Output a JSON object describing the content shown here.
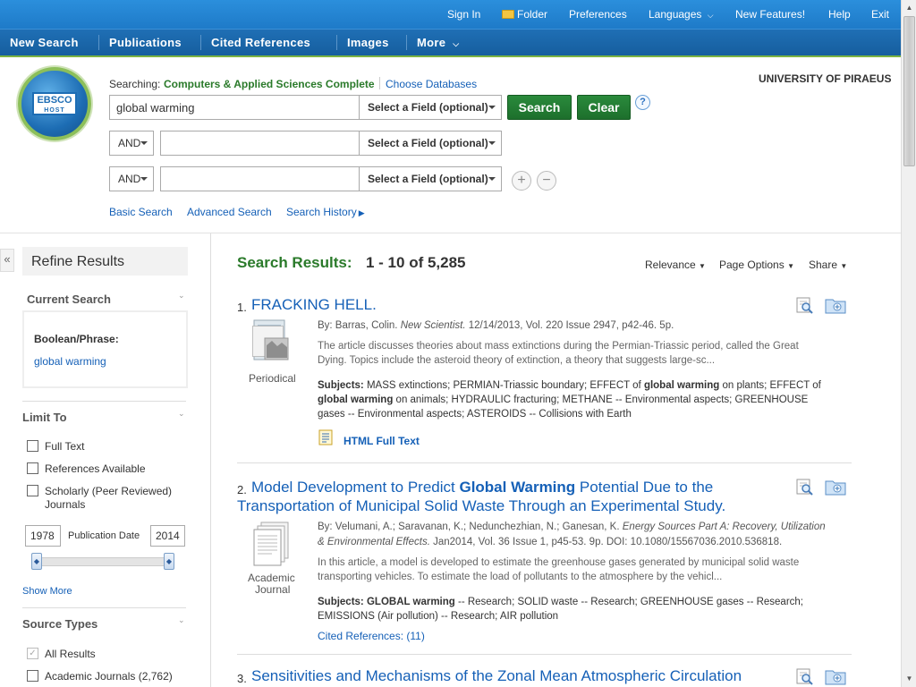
{
  "topbar": {
    "sign_in": "Sign In",
    "folder": "Folder",
    "preferences": "Preferences",
    "languages": "Languages",
    "new_features": "New Features!",
    "help": "Help",
    "exit": "Exit"
  },
  "nav": {
    "new_search": "New Search",
    "publications": "Publications",
    "cited_references": "Cited References",
    "images": "Images",
    "more": "More"
  },
  "logo": {
    "line1": "EBSCO",
    "line2": "HOST"
  },
  "search": {
    "searching_label": "Searching:",
    "database": "Computers & Applied Sciences Complete",
    "choose_databases": "Choose Databases",
    "query1": "global warming",
    "field_select": "Select a Field (optional)",
    "bool1": "AND",
    "bool2": "AND",
    "search_btn": "Search",
    "clear_btn": "Clear",
    "help": "?",
    "basic_search": "Basic Search",
    "advanced_search": "Advanced Search",
    "search_history": "Search History"
  },
  "institution": "UNIVERSITY OF PIRAEUS",
  "sidebar": {
    "collapse": "«",
    "refine_results": "Refine Results",
    "current_search": "Current Search",
    "boolean_phrase": "Boolean/Phrase:",
    "current_term": "global warming",
    "limit_to": "Limit To",
    "full_text": "Full Text",
    "references_available": "References Available",
    "scholarly_1": "Scholarly (Peer Reviewed)",
    "scholarly_2": "Journals",
    "date_from": "1978",
    "publication_date": "Publication Date",
    "date_to": "2014",
    "show_more": "Show More",
    "source_types": "Source Types",
    "all_results": "All Results",
    "academic_journals": "Academic Journals (2,762)"
  },
  "results": {
    "heading": "Search Results:",
    "range": "1 - 10 of 5,285",
    "relevance": "Relevance",
    "page_options": "Page Options",
    "share": "Share",
    "items": [
      {
        "num": "1.",
        "title": "FRACKING HELL.",
        "type": "Periodical",
        "meta_by": "By: Barras, Colin.",
        "meta_source": "New Scientist.",
        "meta_rest": "12/14/2013, Vol. 220 Issue 2947, p42-46. 5p.",
        "abs1": "The article discusses theories about mass extinctions during the Permian-Triassic period, called the Great",
        "abs2": "Dying. Topics include the asteroid theory of extinction, a theory that suggests large-sc...",
        "subj_label": "Subjects:",
        "subj1": "MASS extinctions; PERMIAN-Triassic boundary; EFFECT of",
        "subj1b": "global warming",
        "subj1c": "on plants; EFFECT of",
        "subj2a": "global warming",
        "subj2b": "on animals; HYDRAULIC fracturing; METHANE -- Environmental aspects; GREENHOUSE",
        "subj3": "gases -- Environmental aspects; ASTEROIDS -- Collisions with Earth",
        "fulltext": "HTML Full Text"
      },
      {
        "num": "2.",
        "title_a": "Model Development to Predict",
        "title_b": "Global Warming",
        "title_c": "Potential Due to the",
        "title_line2": "Transportation of Municipal Solid Waste Through an Experimental Study.",
        "type1": "Academic",
        "type2": "Journal",
        "meta1_by": "By: Velumani, A.; Saravanan, K.; Nedunchezhian, N.; Ganesan, K.",
        "meta1_source": "Energy Sources Part A: Recovery, Utilization",
        "meta2_source": "& Environmental Effects.",
        "meta2_rest": "Jan2014, Vol. 36 Issue 1, p45-53. 9p. DOI: 10.1080/15567036.2010.536818.",
        "abs1": "In this article, a model is developed to estimate the greenhouse gases generated by municipal solid waste",
        "abs2": "transporting vehicles. To estimate the load of pollutants to the atmosphere by the vehicl...",
        "subj_label": "Subjects:",
        "subj1b": "GLOBAL warming",
        "subj1c": "-- Research; SOLID waste -- Research; GREENHOUSE gases -- Research;",
        "subj2": "EMISSIONS (Air pollution) -- Research; AIR pollution",
        "cited": "Cited References: (11)"
      },
      {
        "num": "3.",
        "title": "Sensitivities and Mechanisms of the Zonal Mean Atmospheric Circulation"
      }
    ]
  }
}
